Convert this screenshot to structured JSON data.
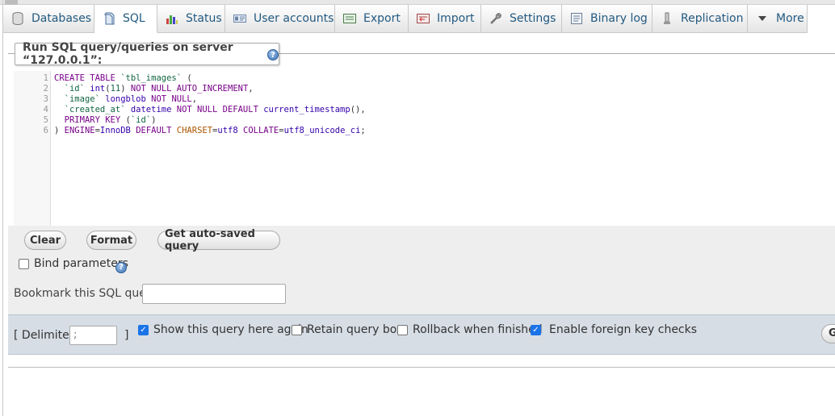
{
  "tabs": [
    {
      "label": "Databases",
      "icon": "database-icon"
    },
    {
      "label": "SQL",
      "icon": "sql-page-icon",
      "active": true
    },
    {
      "label": "Status",
      "icon": "status-chart-icon"
    },
    {
      "label": "User accounts",
      "icon": "user-accounts-icon"
    },
    {
      "label": "Export",
      "icon": "export-icon"
    },
    {
      "label": "Import",
      "icon": "import-icon"
    },
    {
      "label": "Settings",
      "icon": "wrench-icon"
    },
    {
      "label": "Binary log",
      "icon": "binary-log-icon"
    },
    {
      "label": "Replication",
      "icon": "replication-icon"
    },
    {
      "label": "More",
      "icon": "chevron-down-icon"
    }
  ],
  "query_box": {
    "legend": "Run SQL query/queries on server “127.0.0.1”:",
    "help_glyph": "?"
  },
  "editor": {
    "line_numbers": [
      "1",
      "2",
      "3",
      "4",
      "5",
      "6"
    ]
  },
  "buttons": {
    "clear": "Clear",
    "format": "Format",
    "auto_saved": "Get auto-saved query"
  },
  "bind_parameters": {
    "label": "Bind parameters",
    "checked": false
  },
  "bookmark": {
    "label": "Bookmark this SQL query:",
    "value": ""
  },
  "delimiter": {
    "open": "[ Delimiter",
    "value": ";",
    "close": "]"
  },
  "options": {
    "show_query": {
      "label": "Show this query here again",
      "checked": true
    },
    "retain_box": {
      "label": "Retain query box",
      "checked": false
    },
    "rollback": {
      "label": "Rollback when finished",
      "checked": false
    },
    "foreign_keys": {
      "label": "Enable foreign key checks",
      "checked": true
    }
  },
  "go_button_partial": "G",
  "colors": {
    "tab_text": "#235a81",
    "checkbox_checked": "#1a73e8",
    "bottom_bar": "#d6dde5",
    "controls_bg": "#eeeeee"
  }
}
